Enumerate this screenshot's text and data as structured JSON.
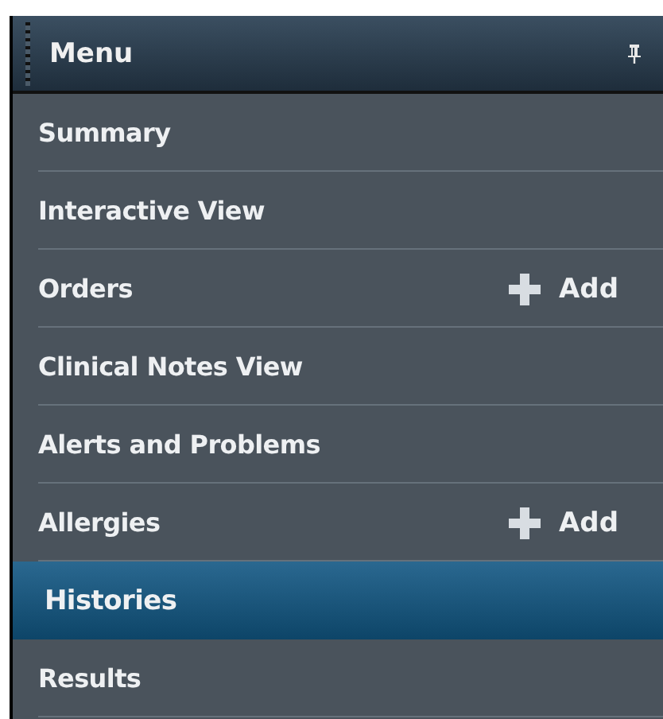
{
  "menu": {
    "title": "Menu",
    "pinned": true,
    "items": [
      {
        "label": "Summary",
        "selected": false
      },
      {
        "label": "Interactive View",
        "selected": false
      },
      {
        "label": "Orders",
        "selected": false,
        "add_label": "Add"
      },
      {
        "label": "Clinical Notes View",
        "selected": false
      },
      {
        "label": "Alerts and Problems",
        "selected": false
      },
      {
        "label": "Allergies",
        "selected": false,
        "add_label": "Add"
      },
      {
        "label": "Histories",
        "selected": true
      },
      {
        "label": "Results",
        "selected": false
      }
    ]
  }
}
